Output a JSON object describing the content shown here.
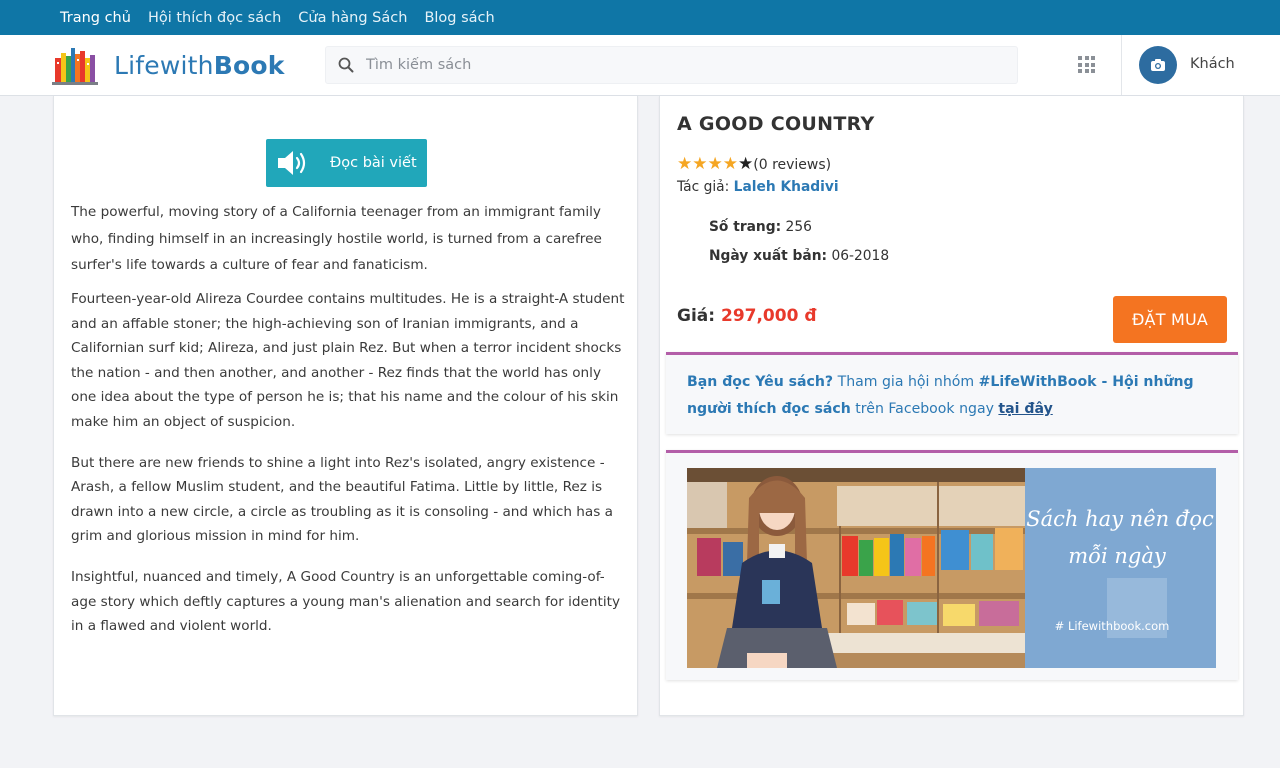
{
  "topnav": {
    "items": [
      "Trang chủ",
      "Hội thích đọc sách",
      "Cửa hàng Sách",
      "Blog sách"
    ]
  },
  "header": {
    "logo_text_light": "Lifewith",
    "logo_text_bold": "Book",
    "search_placeholder": "Tìm kiếm sách",
    "user_name": "Khách"
  },
  "article": {
    "read_button_label": "Đọc bài viết",
    "paragraphs": [
      "The powerful, moving story of a California teenager from an immigrant family who, finding himself in an increasingly hostile world, is turned from a carefree surfer's life towards a culture of fear and fanaticism.",
      "Fourteen-year-old Alireza Courdee contains multitudes. He is a straight-A student and an affable stoner; the high-achieving son of Iranian immigrants, and a Californian surf kid; Alireza, and just plain Rez. But when a terror incident shocks the nation - and then another, and another - Rez finds that the world has only one idea about the type of person he is; that his name and the colour of his skin make him an object of suspicion.",
      "But there are new friends to shine a light into Rez's isolated, angry existence - Arash, a fellow Muslim student, and the beautiful Fatima. Little by little, Rez is drawn into a new circle, a circle as troubling as it is consoling - and which has a grim and glorious mission in mind for him.",
      "Insightful, nuanced and timely, A Good Country is an unforgettable coming-of-age story which deftly captures a young man's alienation and search for identity in a flawed and violent world."
    ]
  },
  "book": {
    "title": "A GOOD COUNTRY",
    "rating_stars": 4,
    "rating_max": 5,
    "reviews_text": "(0 reviews)",
    "author_label": "Tác giả: ",
    "author": "Laleh Khadivi",
    "pages_label": "Số trang:",
    "pages": "256",
    "published_label": "Ngày xuất bản:",
    "published": "06-2018",
    "price_label": "Giá:",
    "price": "297,000 đ",
    "buy_label": "ĐẶT MUA"
  },
  "promo": {
    "part1": "Bạn đọc Yêu sách?",
    "part2": " Tham gia hội nhóm ",
    "part3": "#LifeWithBook - Hội những người thích đọc sách",
    "part4": " trên Facebook ngay ",
    "link": "tại đây"
  },
  "banner": {
    "line1": "Sách hay nên đọc",
    "line2": "mỗi ngày",
    "site": "# Lifewithbook.com"
  },
  "colors": {
    "topnav": "#0f76a6",
    "brand_blue": "#2c79b4",
    "read_button": "#21a7ba",
    "buy_button": "#f47421",
    "price": "#e8392b",
    "accent_border": "#b35ea8",
    "star": "#f5a623"
  },
  "icons": {
    "search": "search-icon",
    "apps": "grid-icon",
    "avatar": "camera-icon",
    "read": "speaker-icon",
    "star": "star-icon"
  }
}
